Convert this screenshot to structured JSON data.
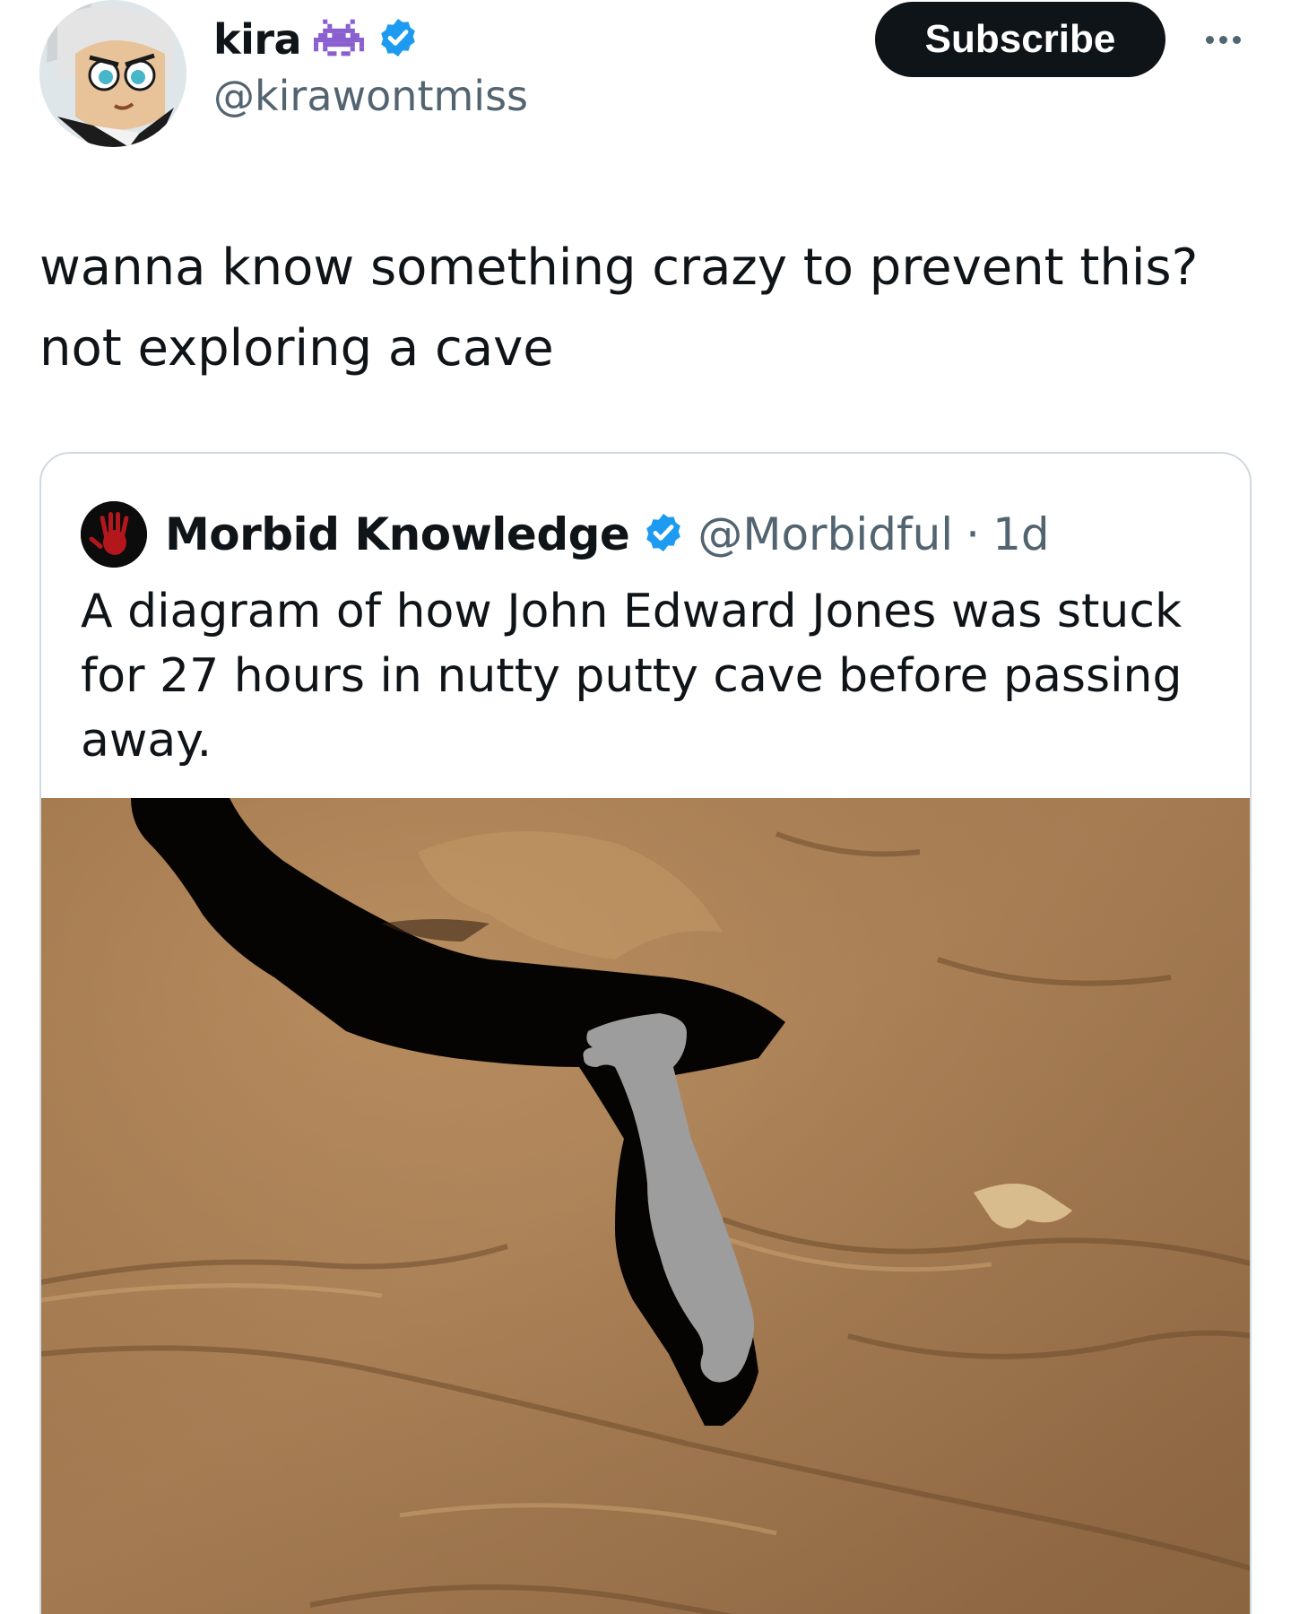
{
  "author": {
    "name": "kira",
    "handle": "@kirawontmiss",
    "name_emoji_icon": "space-invader-icon",
    "verified": true
  },
  "actions": {
    "subscribe_label": "Subscribe",
    "more_icon": "more-horizontal-icon"
  },
  "tweet": {
    "lines": [
      "wanna know something crazy to prevent this?",
      "not exploring a cave"
    ]
  },
  "quoted": {
    "name": "Morbid Knowledge",
    "handle": "@Morbidful",
    "separator": "·",
    "time": "1d",
    "verified": true,
    "avatar_icon": "red-handprint-icon",
    "text_lines": [
      "A diagram of how John Edward Jones was stuck",
      "for 27 hours in nutty putty cave before passing",
      "away."
    ],
    "media": {
      "subject": "cave-rock-diagram",
      "colors": {
        "rock": "#a97c4e",
        "void": "#060403",
        "figure": "#9d9d9d"
      }
    }
  },
  "colors": {
    "text": "#0f1419",
    "secondary": "#536471",
    "verified": "#1d9bf0",
    "border": "#cfd9de",
    "button_bg": "#0f1419"
  }
}
